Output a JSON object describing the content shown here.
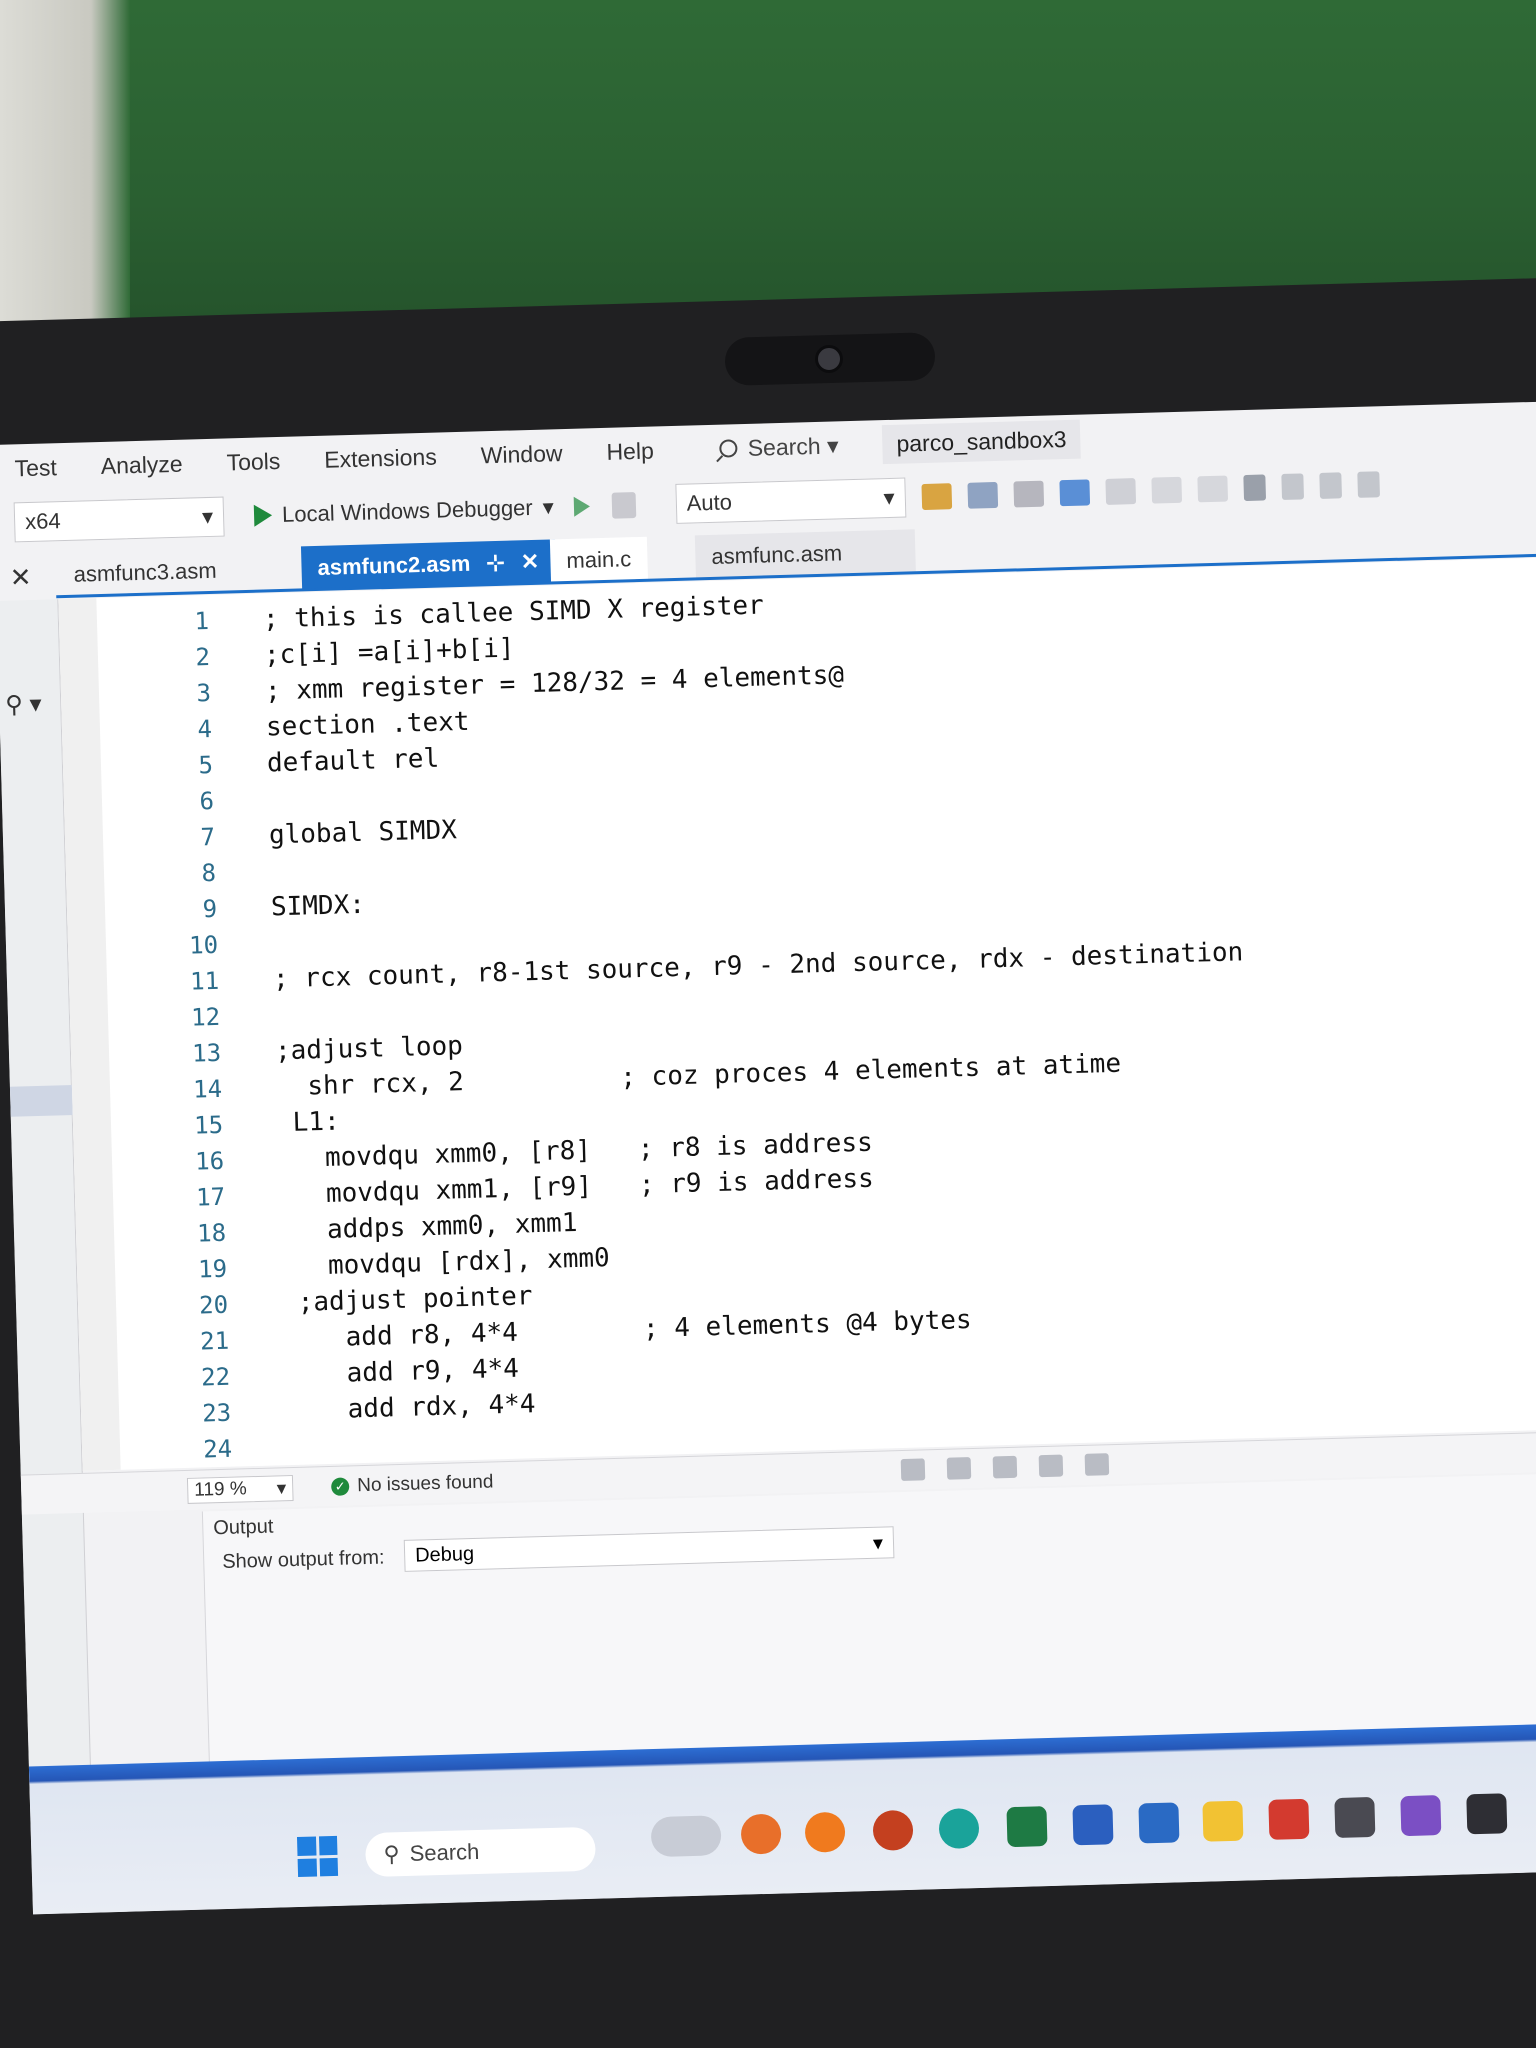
{
  "menu": {
    "items": [
      "Test",
      "Analyze",
      "Tools",
      "Extensions",
      "Window",
      "Help"
    ],
    "search_label": "Search",
    "solution_name": "parco_sandbox3"
  },
  "toolbar": {
    "platform": "x64",
    "debugger_label": "Local Windows Debugger",
    "configuration": "Auto"
  },
  "tabs": {
    "t1": "asmfunc3.asm",
    "t2": "asmfunc2.asm",
    "t3": "main.c",
    "t4": "asmfunc.asm",
    "active": "asmfunc2.asm"
  },
  "editor": {
    "lines": [
      {
        "n": "1",
        "code": "; this is callee SIMD X register"
      },
      {
        "n": "2",
        "code": ";c[i] =a[i]+b[i]"
      },
      {
        "n": "3",
        "code": "; xmm register = 128/32 = 4 elements@"
      },
      {
        "n": "4",
        "code": "section .text"
      },
      {
        "n": "5",
        "code": "default rel"
      },
      {
        "n": "6",
        "code": ""
      },
      {
        "n": "7",
        "code": "global SIMDX"
      },
      {
        "n": "8",
        "code": ""
      },
      {
        "n": "9",
        "code": "SIMDX:"
      },
      {
        "n": "10",
        "code": ""
      },
      {
        "n": "11",
        "code": "; rcx count, r8-1st source, r9 - 2nd source, rdx - destination"
      },
      {
        "n": "12",
        "code": ""
      },
      {
        "n": "13",
        "code": ";adjust loop"
      },
      {
        "n": "14",
        "code": "  shr rcx, 2          ; coz proces 4 elements at atime"
      },
      {
        "n": "15",
        "code": " L1:"
      },
      {
        "n": "16",
        "code": "   movdqu xmm0, [r8]   ; r8 is address"
      },
      {
        "n": "17",
        "code": "   movdqu xmm1, [r9]   ; r9 is address"
      },
      {
        "n": "18",
        "code": "   addps xmm0, xmm1"
      },
      {
        "n": "19",
        "code": "   movdqu [rdx], xmm0"
      },
      {
        "n": "20",
        "code": " ;adjust pointer"
      },
      {
        "n": "21",
        "code": "    add r8, 4*4        ; 4 elements @4 bytes"
      },
      {
        "n": "22",
        "code": "    add r9, 4*4"
      },
      {
        "n": "23",
        "code": "    add rdx, 4*4"
      },
      {
        "n": "24",
        "code": ""
      }
    ]
  },
  "status": {
    "zoom": "119 %",
    "issues": "No issues found"
  },
  "output": {
    "title": "Output",
    "from_label": "Show output from:",
    "source": "Debug"
  },
  "taskbar": {
    "search_label": "Search"
  },
  "colors": {
    "accent": "#1c6fc9",
    "success": "#1f8a3c",
    "line_number": "#2b6b8a"
  }
}
